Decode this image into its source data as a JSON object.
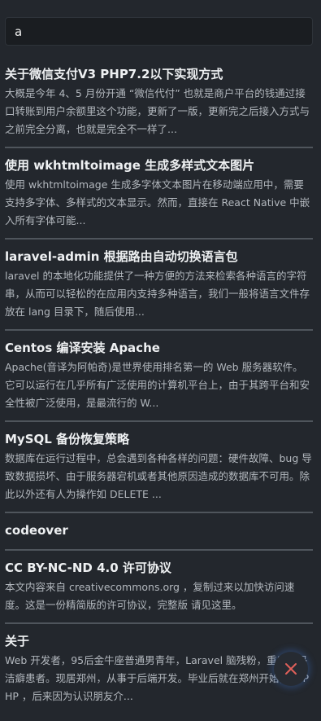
{
  "search": {
    "value": "a",
    "placeholder": ""
  },
  "results": [
    {
      "title": "关于微信支付V3 PHP7.2以下实现方式",
      "excerpt": "大概是今年 4、5 月份开通 “微信代付” 也就是商户平台的钱通过接口转账到用户余额里这个功能，更新了一版，更新完之后接入方式与之前完全分离，也就是完全不一样了..."
    },
    {
      "title": "使用 wkhtmltoimage 生成多样式文本图片",
      "excerpt": "使用 wkhtmltoimage 生成多字体文本图片在移动端应用中，需要支持多字体、多样式的文本显示。然而，直接在 React Native 中嵌入所有字体可能..."
    },
    {
      "title": "laravel-admin 根据路由自动切换语言包",
      "excerpt": "laravel 的本地化功能提供了一种方便的方法来检索各种语言的字符串，从而可以轻松的在应用内支持多种语言，我们一般将语言文件存放在 lang 目录下，随后使用..."
    },
    {
      "title": "Centos 编译安装 Apache",
      "excerpt": "Apache(音译为阿帕奇)是世界使用排名第一的 Web 服务器软件。它可以运行在几乎所有广泛使用的计算机平台上，由于其跨平台和安全性被广泛使用，是最流行的 W..."
    },
    {
      "title": "MySQL 备份恢复策略",
      "excerpt": "数据库在运行过程中，总会遇到各种各样的问题：硬件故障、bug 导致数据损坏、由于服务器宕机或者其他原因造成的数据库不可用。除此以外还有人为操作如 DELETE ..."
    },
    {
      "title": "codeover",
      "excerpt": ""
    },
    {
      "title": "CC BY-NC-ND 4.0 许可协议",
      "excerpt": "本文内容来自 creativecommons.org ，复制过来以加快访问速度。这是一份精简版的许可协议，完整版 请见这里。"
    },
    {
      "title": "关于",
      "excerpt": "Web 开发者，95后金牛座普通男青年，Laravel 脑残粉，重度代码洁癖患者。现居郑州，从事于后端开发。毕业后就在郑州开始做的 PHP ，后来因为认识朋友介..."
    }
  ],
  "close_button": {
    "icon": "close-icon",
    "color": "#e0605a"
  }
}
